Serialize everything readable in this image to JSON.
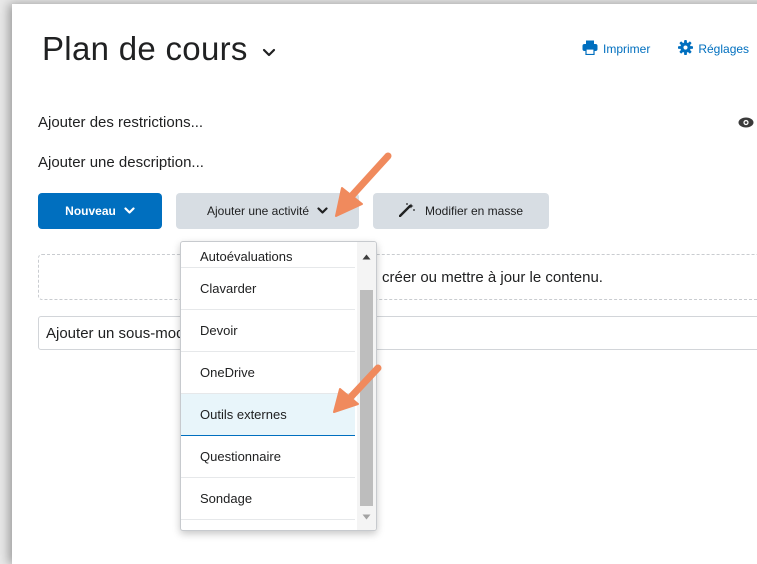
{
  "header": {
    "title": "Plan de cours",
    "print_label": "Imprimer",
    "settings_label": "Réglages"
  },
  "course": {
    "add_restrictions": "Ajouter des restrictions...",
    "add_description": "Ajouter une description..."
  },
  "toolbar": {
    "new_label": "Nouveau",
    "add_activity_label": "Ajouter une activité",
    "bulk_edit_label": "Modifier en masse"
  },
  "dropzone": {
    "text": "créer ou mettre à jour le contenu."
  },
  "submodule": {
    "placeholder": "Ajouter un sous-module..."
  },
  "activity_menu": {
    "items": [
      {
        "label": "Autoévaluations"
      },
      {
        "label": "Clavarder"
      },
      {
        "label": "Devoir"
      },
      {
        "label": "OneDrive"
      },
      {
        "label": "Outils externes",
        "selected": true
      },
      {
        "label": "Questionnaire"
      },
      {
        "label": "Sondage"
      }
    ]
  },
  "colors": {
    "primary": "#006fbf",
    "secondary_button": "#d7dde3",
    "selected_item_bg": "#e8f5fa",
    "annotation_arrow": "#f08a5d"
  }
}
